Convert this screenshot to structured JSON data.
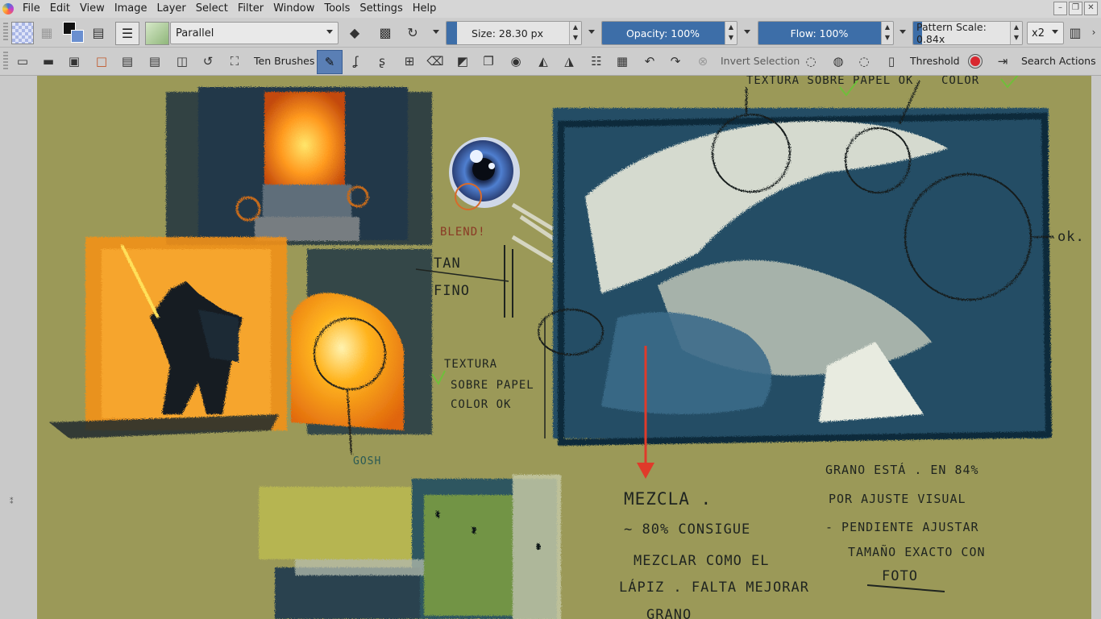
{
  "menubar": {
    "items": [
      "File",
      "Edit",
      "View",
      "Image",
      "Layer",
      "Select",
      "Filter",
      "Window",
      "Tools",
      "Settings",
      "Help"
    ]
  },
  "toolbar1": {
    "brush_mode": "Parallel",
    "size_label": "Size: 28.30 px",
    "opacity_label": "Opacity: 100%",
    "flow_label": "Flow: 100%",
    "pattern_scale_label": "Pattern Scale: 0.84x",
    "zoom_multiplier": "x2",
    "size_fill": 0.08,
    "opacity_fill": 1.0,
    "flow_fill": 1.0,
    "pattern_fill": 0.08
  },
  "toolbar2": {
    "brush_set": "Ten Brushes",
    "invert_selection": "Invert Selection",
    "threshold": "Threshold",
    "search_actions": "Search Actions"
  },
  "canvas_notes": {
    "note_top": "TEXTURA SOBRE PAPEL OK",
    "note_color": "COLOR",
    "note_ok": "ok.",
    "note_blend": "BLEND!",
    "note_tan": "TAN",
    "note_fino": "FINO",
    "note_textura1": "TEXTURA",
    "note_textura2": "SOBRE PAPEL",
    "note_textura3": "COLOR OK",
    "note_gosh": "GOSH",
    "note_mezcla1": "MEZCLA .",
    "note_mezcla2": "~ 80% CONSIGUE",
    "note_mezcla3": "MEZCLAR COMO EL",
    "note_mezcla4": "LÁPIZ . FALTA MEJORAR",
    "note_mezcla5": "GRANO",
    "note_grano1": "GRANO ESTÁ . EN 84%",
    "note_grano2": "POR AJUSTE VISUAL",
    "note_grano3": "- PENDIENTE AJUSTAR",
    "note_grano4": "TAMAÑO EXACTO CON",
    "note_grano5": "FOTO"
  },
  "colors": {
    "paper": "#9b9958",
    "accent_blue": "#3d6ea8",
    "ink": "#1f2420",
    "fire_orange": "#f7961c",
    "check_green": "#6fbf3a",
    "red_arrow": "#e03a2a"
  }
}
